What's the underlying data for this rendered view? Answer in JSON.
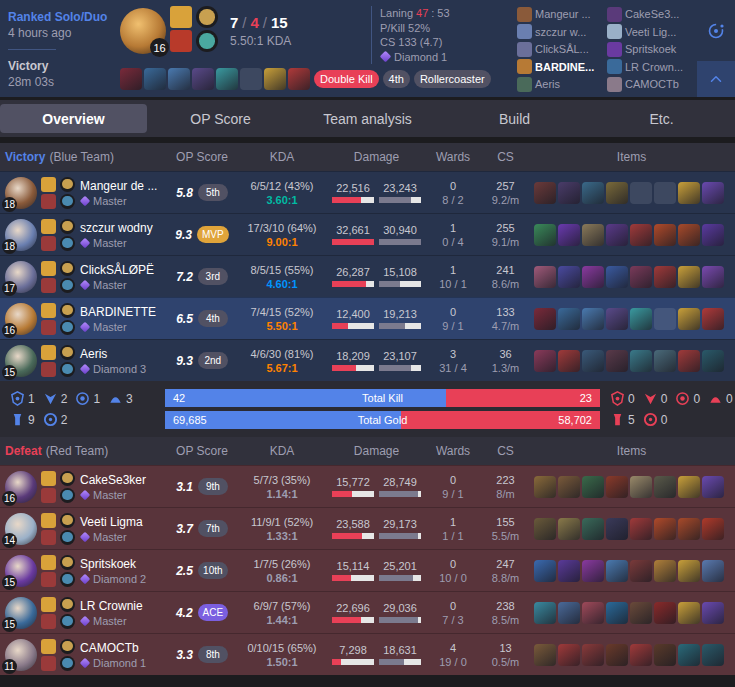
{
  "header": {
    "queue": "Ranked Solo/Duo",
    "time_ago": "4 hours ago",
    "result": "Victory",
    "duration": "28m 03s",
    "champion": {
      "level": "16",
      "color": "#b77a35"
    },
    "kda": {
      "kills": "7",
      "deaths": "4",
      "assists": "15",
      "separator": "/"
    },
    "kda_ratio": "5.50:1 KDA",
    "items": [
      {
        "empty": false,
        "color": "#7a2a3a"
      },
      {
        "empty": false,
        "color": "#3a6a9a"
      },
      {
        "empty": false,
        "color": "#4a7ab0"
      },
      {
        "empty": false,
        "color": "#5a4a8a"
      },
      {
        "empty": false,
        "color": "#3a9aa0"
      },
      {
        "empty": true
      },
      {
        "empty": false,
        "color": "#c9a03a"
      },
      {
        "empty": false,
        "color": "#b03a3a"
      }
    ],
    "tags": [
      {
        "label": "Double Kill",
        "color": "#e84057"
      },
      {
        "label": "4th",
        "color": "#515163"
      },
      {
        "label": "Rollercoaster",
        "color": "#515163"
      }
    ],
    "stats": {
      "laning": {
        "label": "Laning",
        "ours": "47",
        "separator": ":",
        "theirs": "53"
      },
      "p_kill": "P/Kill 52%",
      "cs": "CS 133 (4.7)",
      "tier": "Diamond 1"
    },
    "participants": [
      [
        {
          "name": "Mangeur ...",
          "color": "#8a5a3a",
          "self": false
        },
        {
          "name": "szczur w...",
          "color": "#6a7fb0",
          "self": false
        },
        {
          "name": "ClickSÅL...",
          "color": "#6b6f9a",
          "self": false
        },
        {
          "name": "BARDINE...",
          "color": "#b77a35",
          "self": true
        },
        {
          "name": "Aeris",
          "color": "#4a6a5a",
          "self": false
        }
      ],
      [
        {
          "name": "CakeSe3...",
          "color": "#5a3a7a",
          "self": false
        },
        {
          "name": "Veeti Lig...",
          "color": "#9ab0c8",
          "self": false
        },
        {
          "name": "Spritskoek",
          "color": "#6a3aa0",
          "self": false
        },
        {
          "name": "LR Crown...",
          "color": "#3a6a9a",
          "self": false
        },
        {
          "name": "CAMOCTb",
          "color": "#8a7a8a",
          "self": false
        }
      ]
    ],
    "expanded": true
  },
  "tabs": [
    {
      "label": "Overview",
      "selected": true
    },
    {
      "label": "OP Score",
      "selected": false
    },
    {
      "label": "Team analysis",
      "selected": false
    },
    {
      "label": "Build",
      "selected": false
    },
    {
      "label": "Etc.",
      "selected": false
    }
  ],
  "teams": [
    {
      "kind": "blue",
      "result": "Victory",
      "name": "(Blue Team)",
      "color": "#5383e8",
      "columns": [
        "OP Score",
        "KDA",
        "Damage",
        "Wards",
        "CS",
        "Items"
      ],
      "players": [
        {
          "name": "Mangeur de ...",
          "level": "18",
          "tier": "Master",
          "champion_color": "#8a5a3a",
          "score": "5.8",
          "rank": {
            "label": "5th",
            "kind": "normal"
          },
          "kda": "6/5/12 (43%)",
          "ratio": "3.60:1",
          "ratio_color": "#00bba3",
          "damage_dealt": "22,516",
          "damage_dealt_level": 0.69,
          "damage_taken": "23,243",
          "damage_taken_level": 0.75,
          "wards": "0",
          "wards_detail": "8 / 2",
          "cs": "257",
          "cs_per_min": "9.2/m",
          "highlighted": false,
          "items": [
            {
              "empty": false,
              "color": "#6b3a3a"
            },
            {
              "empty": false,
              "color": "#4a3c6a"
            },
            {
              "empty": false,
              "color": "#3a6a8a"
            },
            {
              "empty": false,
              "color": "#7a6a3a"
            },
            {
              "empty": true
            },
            {
              "empty": true
            },
            {
              "empty": false,
              "color": "#c9a03a"
            },
            {
              "empty": false,
              "color": "#6a4ab0"
            }
          ]
        },
        {
          "name": "szczur wodny",
          "level": "18",
          "tier": "Master",
          "champion_color": "#6a7fb0",
          "score": "9.3",
          "rank": {
            "label": "MVP",
            "kind": "mvp"
          },
          "kda": "17/3/10 (64%)",
          "ratio": "9.00:1",
          "ratio_color": "#ff8200",
          "damage_dealt": "32,661",
          "damage_dealt_level": 1.0,
          "damage_taken": "30,940",
          "damage_taken_level": 1.0,
          "wards": "1",
          "wards_detail": "0 / 4",
          "cs": "255",
          "cs_per_min": "9.1/m",
          "highlighted": false,
          "items": [
            {
              "empty": false,
              "color": "#3a8a5a"
            },
            {
              "empty": false,
              "color": "#6a3ab0"
            },
            {
              "empty": false,
              "color": "#8a7a5a"
            },
            {
              "empty": false,
              "color": "#5a3a8a"
            },
            {
              "empty": false,
              "color": "#a03a3a"
            },
            {
              "empty": false,
              "color": "#b04a2a"
            },
            {
              "empty": false,
              "color": "#a84a2a"
            },
            {
              "empty": false,
              "color": "#5a3aa0"
            }
          ]
        },
        {
          "name": "ClickSÅLØPË",
          "level": "17",
          "tier": "Master",
          "champion_color": "#6b6f9a",
          "score": "7.2",
          "rank": {
            "label": "3rd",
            "kind": "normal"
          },
          "kda": "8/5/15 (55%)",
          "ratio": "4.60:1",
          "ratio_color": "#0093ff",
          "damage_dealt": "26,287",
          "damage_dealt_level": 0.8,
          "damage_taken": "15,108",
          "damage_taken_level": 0.49,
          "wards": "1",
          "wards_detail": "10 / 1",
          "cs": "241",
          "cs_per_min": "8.6/m",
          "highlighted": false,
          "items": [
            {
              "empty": false,
              "color": "#a05a7a"
            },
            {
              "empty": false,
              "color": "#4a4aa0"
            },
            {
              "empty": false,
              "color": "#8a3aa0"
            },
            {
              "empty": false,
              "color": "#3a5aa0"
            },
            {
              "empty": false,
              "color": "#7a3a5a"
            },
            {
              "empty": false,
              "color": "#a03a3a"
            },
            {
              "empty": false,
              "color": "#c9a03a"
            },
            {
              "empty": false,
              "color": "#7a4ab0"
            }
          ]
        },
        {
          "name": "BARDINETTE",
          "level": "16",
          "tier": "Master",
          "champion_color": "#b77a35",
          "score": "6.5",
          "rank": {
            "label": "4th",
            "kind": "normal"
          },
          "kda": "7/4/15 (52%)",
          "ratio": "5.50:1",
          "ratio_color": "#ff8200",
          "damage_dealt": "12,400",
          "damage_dealt_level": 0.38,
          "damage_taken": "19,213",
          "damage_taken_level": 0.62,
          "wards": "0",
          "wards_detail": "9 / 1",
          "cs": "133",
          "cs_per_min": "4.7/m",
          "highlighted": true,
          "items": [
            {
              "empty": false,
              "color": "#7a2a3a"
            },
            {
              "empty": false,
              "color": "#3a6a9a"
            },
            {
              "empty": false,
              "color": "#4a7ab0"
            },
            {
              "empty": false,
              "color": "#5a4a8a"
            },
            {
              "empty": false,
              "color": "#3a9aa0"
            },
            {
              "empty": true
            },
            {
              "empty": false,
              "color": "#c9a03a"
            },
            {
              "empty": false,
              "color": "#b03a3a"
            }
          ]
        },
        {
          "name": "Aeris",
          "level": "15",
          "tier": "Diamond 3",
          "champion_color": "#4a6a5a",
          "score": "9.3",
          "rank": {
            "label": "2nd",
            "kind": "normal"
          },
          "kda": "4/6/30 (81%)",
          "ratio": "5.67:1",
          "ratio_color": "#ff8200",
          "damage_dealt": "18,209",
          "damage_dealt_level": 0.56,
          "damage_taken": "23,107",
          "damage_taken_level": 0.75,
          "wards": "3",
          "wards_detail": "31 / 4",
          "cs": "36",
          "cs_per_min": "1.3/m",
          "highlighted": false,
          "items": [
            {
              "empty": false,
              "color": "#8a3a5a"
            },
            {
              "empty": false,
              "color": "#a03a3a"
            },
            {
              "empty": false,
              "color": "#3a5a7a"
            },
            {
              "empty": false,
              "color": "#5a3a4a"
            },
            {
              "empty": false,
              "color": "#3a7a8a"
            },
            {
              "empty": false,
              "color": "#4a6a7a"
            },
            {
              "empty": false,
              "color": "#a03a3a"
            },
            {
              "empty": false,
              "color": "#2a5a6a"
            }
          ]
        }
      ]
    },
    {
      "kind": "red",
      "result": "Defeat",
      "name": "(Red Team)",
      "color": "#e84057",
      "columns": [
        "OP Score",
        "KDA",
        "Damage",
        "Wards",
        "CS",
        "Items"
      ],
      "players": [
        {
          "name": "CakeSe3ker",
          "level": "16",
          "tier": "Master",
          "champion_color": "#5a3a7a",
          "score": "3.1",
          "rank": {
            "label": "9th",
            "kind": "normal"
          },
          "kda": "5/7/3 (35%)",
          "ratio": "1.14:1",
          "ratio_color": "#9e9eb1",
          "damage_dealt": "15,772",
          "damage_dealt_level": 0.48,
          "damage_taken": "28,749",
          "damage_taken_level": 0.93,
          "wards": "0",
          "wards_detail": "9 / 1",
          "cs": "223",
          "cs_per_min": "8/m",
          "highlighted": false,
          "items": [
            {
              "empty": false,
              "color": "#8a6a3a"
            },
            {
              "empty": false,
              "color": "#7a5a3a"
            },
            {
              "empty": false,
              "color": "#3a6a4a"
            },
            {
              "empty": false,
              "color": "#8a3a2a"
            },
            {
              "empty": false,
              "color": "#9a8a6a"
            },
            {
              "empty": false,
              "color": "#5a5a4a"
            },
            {
              "empty": false,
              "color": "#c9a03a"
            },
            {
              "empty": false,
              "color": "#6a4ab0"
            }
          ]
        },
        {
          "name": "Veeti Ligma",
          "level": "14",
          "tier": "Master",
          "champion_color": "#9ab0c8",
          "score": "3.7",
          "rank": {
            "label": "7th",
            "kind": "normal"
          },
          "kda": "11/9/1 (52%)",
          "ratio": "1.33:1",
          "ratio_color": "#9e9eb1",
          "damage_dealt": "23,588",
          "damage_dealt_level": 0.72,
          "damage_taken": "29,173",
          "damage_taken_level": 0.94,
          "wards": "1",
          "wards_detail": "1 / 1",
          "cs": "155",
          "cs_per_min": "5.5/m",
          "highlighted": false,
          "items": [
            {
              "empty": false,
              "color": "#6a5a3a"
            },
            {
              "empty": false,
              "color": "#8a7a4a"
            },
            {
              "empty": false,
              "color": "#3a6a5a"
            },
            {
              "empty": false,
              "color": "#3a3a5a"
            },
            {
              "empty": false,
              "color": "#a03a3a"
            },
            {
              "empty": false,
              "color": "#b04a2a"
            },
            {
              "empty": false,
              "color": "#a84a2a"
            },
            {
              "empty": false,
              "color": "#b03a2a"
            }
          ]
        },
        {
          "name": "Spritskoek",
          "level": "15",
          "tier": "Diamond 2",
          "champion_color": "#6a3aa0",
          "score": "2.5",
          "rank": {
            "label": "10th",
            "kind": "normal"
          },
          "kda": "1/7/5 (26%)",
          "ratio": "0.86:1",
          "ratio_color": "#9e9eb1",
          "damage_dealt": "15,114",
          "damage_dealt_level": 0.46,
          "damage_taken": "25,201",
          "damage_taken_level": 0.81,
          "wards": "0",
          "wards_detail": "10 / 0",
          "cs": "247",
          "cs_per_min": "8.8/m",
          "highlighted": false,
          "items": [
            {
              "empty": false,
              "color": "#3a6ab0"
            },
            {
              "empty": false,
              "color": "#5a3a9a"
            },
            {
              "empty": false,
              "color": "#8a3aa0"
            },
            {
              "empty": false,
              "color": "#4a7ab0"
            },
            {
              "empty": false,
              "color": "#7a3a3a"
            },
            {
              "empty": false,
              "color": "#b0803a"
            },
            {
              "empty": false,
              "color": "#c9a03a"
            },
            {
              "empty": false,
              "color": "#5a7ab0"
            }
          ]
        },
        {
          "name": "LR Crownie",
          "level": "15",
          "tier": "Master",
          "champion_color": "#3a6a9a",
          "score": "4.2",
          "rank": {
            "label": "ACE",
            "kind": "ace"
          },
          "kda": "6/9/7 (57%)",
          "ratio": "1.44:1",
          "ratio_color": "#9e9eb1",
          "damage_dealt": "22,696",
          "damage_dealt_level": 0.69,
          "damage_taken": "29,036",
          "damage_taken_level": 0.94,
          "wards": "0",
          "wards_detail": "7 / 3",
          "cs": "238",
          "cs_per_min": "8.5/m",
          "highlighted": false,
          "items": [
            {
              "empty": false,
              "color": "#3a8aa0"
            },
            {
              "empty": false,
              "color": "#4a6a9a"
            },
            {
              "empty": false,
              "color": "#a04a5a"
            },
            {
              "empty": false,
              "color": "#2a6a9a"
            },
            {
              "empty": false,
              "color": "#6a4a3a"
            },
            {
              "empty": false,
              "color": "#8a2a2a"
            },
            {
              "empty": false,
              "color": "#c9a03a"
            },
            {
              "empty": false,
              "color": "#6a4ab0"
            }
          ]
        },
        {
          "name": "CAMOCTb",
          "level": "11",
          "tier": "Diamond 1",
          "champion_color": "#8a7a8a",
          "score": "3.3",
          "rank": {
            "label": "8th",
            "kind": "normal"
          },
          "kda": "0/10/15 (65%)",
          "ratio": "1.50:1",
          "ratio_color": "#9e9eb1",
          "damage_dealt": "7,298",
          "damage_dealt_level": 0.22,
          "damage_taken": "18,631",
          "damage_taken_level": 0.6,
          "wards": "4",
          "wards_detail": "19 / 0",
          "cs": "13",
          "cs_per_min": "0.5/m",
          "highlighted": false,
          "items": [
            {
              "empty": false,
              "color": "#7a5a3a"
            },
            {
              "empty": false,
              "color": "#a03a3a"
            },
            {
              "empty": false,
              "color": "#8a3a3a"
            },
            {
              "empty": false,
              "color": "#6a3a2a"
            },
            {
              "empty": false,
              "color": "#a03a3a"
            },
            {
              "empty": false,
              "color": "#5a3a2a"
            },
            {
              "empty": false,
              "color": "#2a6a7a"
            },
            {
              "empty": false,
              "color": "#2a5a6a"
            }
          ]
        }
      ]
    }
  ],
  "summary": {
    "blue_objectives": [
      [
        {
          "kind": "baron",
          "count": "1"
        },
        {
          "kind": "dragon",
          "count": "2"
        },
        {
          "kind": "herald",
          "count": "1"
        },
        {
          "kind": "grub",
          "count": "3"
        }
      ],
      [
        {
          "kind": "tower",
          "count": "9"
        },
        {
          "kind": "inhibitor",
          "count": "2"
        }
      ]
    ],
    "red_objectives": [
      [
        {
          "kind": "baron",
          "count": "0"
        },
        {
          "kind": "dragon",
          "count": "0"
        },
        {
          "kind": "herald",
          "count": "0"
        },
        {
          "kind": "grub",
          "count": "0"
        }
      ],
      [
        {
          "kind": "tower",
          "count": "5"
        },
        {
          "kind": "inhibitor",
          "count": "0"
        }
      ]
    ],
    "bars": [
      {
        "label": "Total Kill",
        "blue": "42",
        "red": "23",
        "level": 0.646
      },
      {
        "label": "Total Gold",
        "blue": "69,685",
        "red": "58,702",
        "level": 0.543
      }
    ]
  }
}
